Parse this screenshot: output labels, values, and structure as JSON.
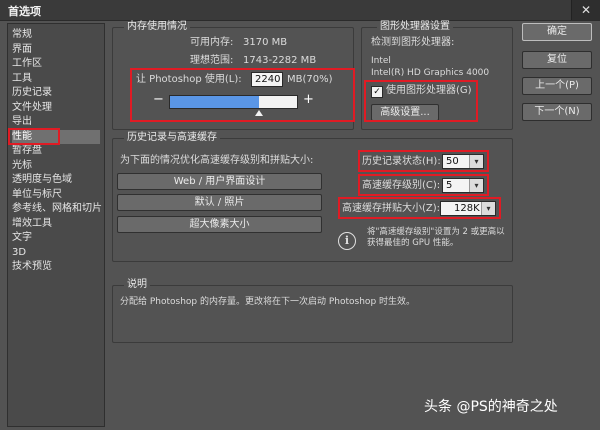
{
  "window": {
    "title": "首选项",
    "close_glyph": "✕"
  },
  "nav": {
    "items": [
      "常规",
      "界面",
      "工作区",
      "工具",
      "历史记录",
      "文件处理",
      "导出",
      "性能",
      "暂存盘",
      "光标",
      "透明度与色域",
      "单位与标尺",
      "参考线、网格和切片",
      "增效工具",
      "文字",
      "3D",
      "技术预览"
    ],
    "selected": "性能"
  },
  "memory": {
    "title": "内存使用情况",
    "available_label": "可用内存:",
    "available_value": "3170 MB",
    "ideal_label": "理想范围:",
    "ideal_value": "1743-2282 MB",
    "let_label": "让 Photoshop 使用(L):",
    "input_value": "2240",
    "unit_pct": "MB(70%)",
    "minus": "−",
    "plus": "+",
    "slider_fraction": 0.7
  },
  "gpu": {
    "title": "图形处理器设置",
    "detected_label": "检测到图形处理器:",
    "vendor": "Intel",
    "model": "Intel(R) HD Graphics 4000",
    "use_gpu_label": "使用图形处理器(G)",
    "use_gpu_checked": true,
    "advanced_button": "高级设置..."
  },
  "history_cache": {
    "title": "历史记录与高速缓存",
    "optimize_label": "为下面的情况优化高速缓存级别和拼贴大小:",
    "presets": [
      "Web / 用户界面设计",
      "默认 / 照片",
      "超大像素大小"
    ],
    "history_states_label": "历史记录状态(H):",
    "history_states_value": "50",
    "cache_levels_label": "高速缓存级别(C):",
    "cache_levels_value": "5",
    "tile_size_label": "高速缓存拼贴大小(Z):",
    "tile_size_value": "128K",
    "hint": "将\"高速缓存级别\"设置为 2 或更高以获得最佳的 GPU 性能。"
  },
  "description": {
    "title": "说明",
    "text": "分配给 Photoshop 的内存量。更改将在下一次启动 Photoshop 时生效。"
  },
  "buttons": {
    "ok": "确定",
    "reset": "复位",
    "prev": "上一个(P)",
    "next": "下一个(N)"
  },
  "watermark": "头条 @PS的神奇之处",
  "colors": {
    "background": "#535353",
    "slider_fill": "#5a96e6",
    "highlight_border": "#e01b24"
  }
}
